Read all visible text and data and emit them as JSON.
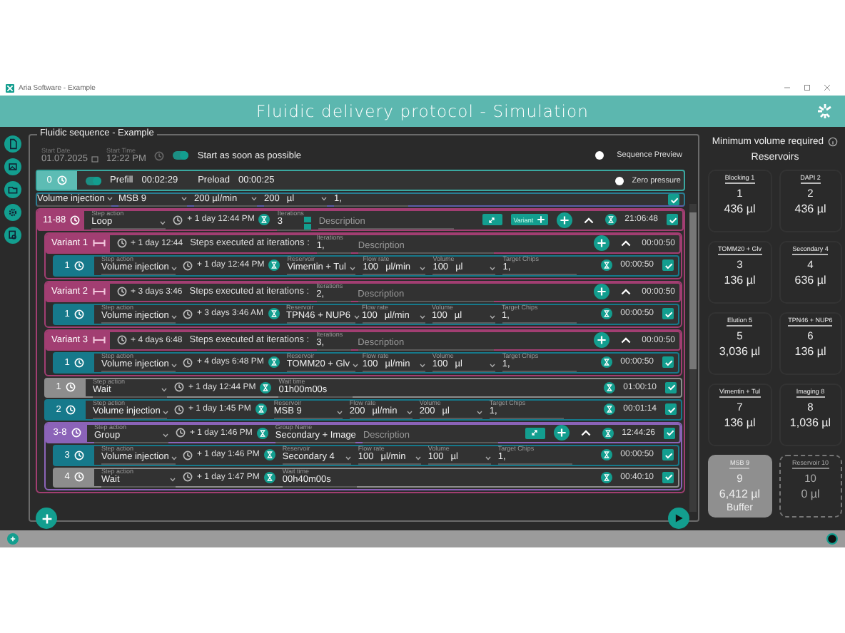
{
  "window": {
    "title": "Aria Software - Example"
  },
  "header": {
    "title": "Fluidic delivery protocol - Simulation"
  },
  "sequence": {
    "title": "Fluidic sequence - Example",
    "start_date": {
      "label": "Start Date",
      "value": "01.07.2025"
    },
    "start_time": {
      "label": "Start Time",
      "value": "12:22 PM"
    },
    "start_asap": {
      "label": "Start as soon as possible",
      "on": true
    },
    "sequence_preview": {
      "label": "Sequence Preview",
      "selected": false
    },
    "prefill": {
      "index": "0",
      "on": true,
      "prefill_label": "Prefill",
      "prefill_time": "00:02:29",
      "preload_label": "Preload",
      "preload_time": "00:00:25"
    },
    "zero_pressure": {
      "label": "Zero pressure",
      "selected": false
    },
    "steps": [
      {
        "kind": "partial",
        "fields": [
          {
            "kind": "action",
            "value": "Volume injection"
          },
          {
            "kind": "select",
            "value": "MSB 9"
          },
          {
            "kind": "measure",
            "value": "200 µl/min"
          },
          {
            "kind": "measure",
            "value": "200",
            "unit": "µl"
          },
          {
            "kind": "text",
            "value": "1,"
          }
        ],
        "checked": true
      },
      {
        "kind": "loop",
        "index": "11-88",
        "fields": [
          {
            "kind": "action",
            "label": "Step action",
            "value": "Loop"
          },
          {
            "kind": "time",
            "value": "+ 1 day 12:44 PM"
          },
          {
            "kind": "spinner",
            "label": "Iterations",
            "value": "3"
          },
          {
            "kind": "description",
            "placeholder": "Description"
          }
        ],
        "actions": [
          {
            "kind": "edit"
          },
          {
            "kind": "variant",
            "label": "Variant"
          },
          {
            "kind": "add"
          },
          {
            "kind": "collapse"
          }
        ],
        "duration": "21:06:48",
        "checked": true,
        "children": [
          {
            "kind": "variant",
            "index": "Variant 1",
            "fields": [
              {
                "kind": "offset",
                "value": "+ 1 day 12:44"
              },
              {
                "kind": "note",
                "value": "Steps executed at iterations :"
              },
              {
                "kind": "iter",
                "label": "Iterations",
                "value": "1,"
              },
              {
                "kind": "description",
                "placeholder": "Description"
              }
            ],
            "actions": [
              {
                "kind": "add"
              },
              {
                "kind": "collapse"
              }
            ],
            "duration": "00:00:50",
            "children": [
              {
                "kind": "injection",
                "index": "1",
                "fields": [
                  {
                    "kind": "action",
                    "label": "Step action",
                    "value": "Volume injection"
                  },
                  {
                    "kind": "time",
                    "value": "+ 1 day 12:44 PM"
                  },
                  {
                    "kind": "select",
                    "label": "Reservoir",
                    "value": "Vimentin + Tul"
                  },
                  {
                    "kind": "measure",
                    "label": "Flow rate",
                    "value": "100",
                    "unit": "µl/min"
                  },
                  {
                    "kind": "measure",
                    "label": "Volume",
                    "value": "100",
                    "unit": "µl"
                  },
                  {
                    "kind": "text",
                    "label": "Target Chips",
                    "value": "1,"
                  }
                ],
                "duration": "00:00:50",
                "checked": true
              }
            ]
          },
          {
            "kind": "variant",
            "index": "Variant 2",
            "fields": [
              {
                "kind": "offset",
                "value": "+ 3 days 3:46"
              },
              {
                "kind": "note",
                "value": "Steps executed at iterations :"
              },
              {
                "kind": "iter",
                "label": "Iterations",
                "value": "2,"
              },
              {
                "kind": "description",
                "placeholder": "Description"
              }
            ],
            "actions": [
              {
                "kind": "add"
              },
              {
                "kind": "collapse"
              }
            ],
            "duration": "00:00:50",
            "children": [
              {
                "kind": "injection",
                "index": "1",
                "fields": [
                  {
                    "kind": "action",
                    "label": "Step action",
                    "value": "Volume injection"
                  },
                  {
                    "kind": "time",
                    "value": "+ 3 days 3:46 AM"
                  },
                  {
                    "kind": "select",
                    "label": "Reservoir",
                    "value": "TPN46 + NUP6"
                  },
                  {
                    "kind": "measure",
                    "label": "Flow rate",
                    "value": "100",
                    "unit": "µl/min"
                  },
                  {
                    "kind": "measure",
                    "label": "Volume",
                    "value": "100",
                    "unit": "µl"
                  },
                  {
                    "kind": "text",
                    "label": "Target Chips",
                    "value": "1,"
                  }
                ],
                "duration": "00:00:50",
                "checked": true
              }
            ]
          },
          {
            "kind": "variant",
            "index": "Variant 3",
            "fields": [
              {
                "kind": "offset",
                "value": "+ 4 days 6:48"
              },
              {
                "kind": "note",
                "value": "Steps executed at iterations :"
              },
              {
                "kind": "iter",
                "label": "Iterations",
                "value": "3,"
              },
              {
                "kind": "description",
                "placeholder": "Description"
              }
            ],
            "actions": [
              {
                "kind": "add"
              },
              {
                "kind": "collapse"
              }
            ],
            "duration": "00:00:50",
            "children": [
              {
                "kind": "injection",
                "index": "1",
                "fields": [
                  {
                    "kind": "action",
                    "label": "Step action",
                    "value": "Volume injection"
                  },
                  {
                    "kind": "time",
                    "value": "+ 4 days 6:48 PM"
                  },
                  {
                    "kind": "select",
                    "label": "Reservoir",
                    "value": "TOMM20 + Glv"
                  },
                  {
                    "kind": "measure",
                    "label": "Flow rate",
                    "value": "100",
                    "unit": "µl/min"
                  },
                  {
                    "kind": "measure",
                    "label": "Volume",
                    "value": "100",
                    "unit": "µl"
                  },
                  {
                    "kind": "text",
                    "label": "Target Chips",
                    "value": "1,"
                  }
                ],
                "duration": "00:00:50",
                "checked": true
              }
            ]
          },
          {
            "kind": "wait",
            "index": "1",
            "fields": [
              {
                "kind": "action",
                "label": "Step action",
                "value": "Wait"
              },
              {
                "kind": "time",
                "value": "+ 1 day 12:44 PM"
              },
              {
                "kind": "text",
                "label": "Wait time",
                "value": "01h00m00s"
              }
            ],
            "duration": "01:00:10",
            "checked": true
          },
          {
            "kind": "injection",
            "index": "2",
            "fields": [
              {
                "kind": "action",
                "label": "Step action",
                "value": "Volume injection"
              },
              {
                "kind": "time",
                "value": "+ 1 day 1:45 PM"
              },
              {
                "kind": "select",
                "label": "Reservoir",
                "value": "MSB 9"
              },
              {
                "kind": "measure",
                "label": "Flow rate",
                "value": "200",
                "unit": "µl/min"
              },
              {
                "kind": "measure",
                "label": "Volume",
                "value": "200",
                "unit": "µl"
              },
              {
                "kind": "text",
                "label": "Target Chips",
                "value": "1,"
              }
            ],
            "duration": "00:01:14",
            "checked": true
          },
          {
            "kind": "group",
            "index": "3-8",
            "fields": [
              {
                "kind": "action",
                "label": "Step action",
                "value": "Group"
              },
              {
                "kind": "time",
                "value": "+ 1 day 1:46 PM"
              },
              {
                "kind": "text",
                "label": "Group Name",
                "value": "Secondary + Image"
              },
              {
                "kind": "description",
                "placeholder": "Description"
              }
            ],
            "actions": [
              {
                "kind": "edit"
              },
              {
                "kind": "add"
              },
              {
                "kind": "collapse"
              }
            ],
            "duration": "12:44:26",
            "checked": true,
            "children": [
              {
                "kind": "injection",
                "index": "3",
                "fields": [
                  {
                    "kind": "action",
                    "label": "Step action",
                    "value": "Volume injection"
                  },
                  {
                    "kind": "time",
                    "value": "+ 1 day 1:46 PM"
                  },
                  {
                    "kind": "select",
                    "label": "Reservoir",
                    "value": "Secondary 4"
                  },
                  {
                    "kind": "measure",
                    "label": "Flow rate",
                    "value": "100",
                    "unit": "µl/min"
                  },
                  {
                    "kind": "measure",
                    "label": "Volume",
                    "value": "100",
                    "unit": "µl"
                  },
                  {
                    "kind": "text",
                    "label": "Target Chips",
                    "value": "1,"
                  }
                ],
                "duration": "00:00:50",
                "checked": true
              },
              {
                "kind": "wait",
                "index": "4",
                "fields": [
                  {
                    "kind": "action",
                    "label": "Step action",
                    "value": "Wait"
                  },
                  {
                    "kind": "time",
                    "value": "+ 1 day 1:47 PM"
                  },
                  {
                    "kind": "text",
                    "label": "Wait time",
                    "value": "00h40m00s"
                  }
                ],
                "duration": "00:40:10",
                "checked": true
              }
            ]
          }
        ]
      }
    ]
  },
  "reservoirs": {
    "title": "Minimum volume required",
    "heading": "Reservoirs",
    "items": [
      {
        "name": "Blocking 1",
        "number": "1",
        "volume": "436 µl",
        "highlighted": false,
        "disabled": false
      },
      {
        "name": "DAPI 2",
        "number": "2",
        "volume": "436 µl",
        "highlighted": false,
        "disabled": false
      },
      {
        "name": "TOMM20 + Glv",
        "number": "3",
        "volume": "136 µl",
        "highlighted": false,
        "disabled": false
      },
      {
        "name": "Secondary 4",
        "number": "4",
        "volume": "636 µl",
        "highlighted": false,
        "disabled": false
      },
      {
        "name": "Elution 5",
        "number": "5",
        "volume": "3,036 µl",
        "highlighted": false,
        "disabled": false
      },
      {
        "name": "TPN46 + NUP6",
        "number": "6",
        "volume": "136 µl",
        "highlighted": false,
        "disabled": false
      },
      {
        "name": "Vimentin + Tul",
        "number": "7",
        "volume": "136 µl",
        "highlighted": false,
        "disabled": false
      },
      {
        "name": "Imaging 8",
        "number": "8",
        "volume": "1,036 µl",
        "highlighted": false,
        "disabled": false
      },
      {
        "name": "MSB 9",
        "number": "9",
        "volume": "6,412 µl",
        "role": "Buffer",
        "highlighted": true,
        "disabled": false
      },
      {
        "name": "Reservoir 10",
        "number": "10",
        "volume": "0 µl",
        "highlighted": false,
        "disabled": true
      }
    ]
  }
}
